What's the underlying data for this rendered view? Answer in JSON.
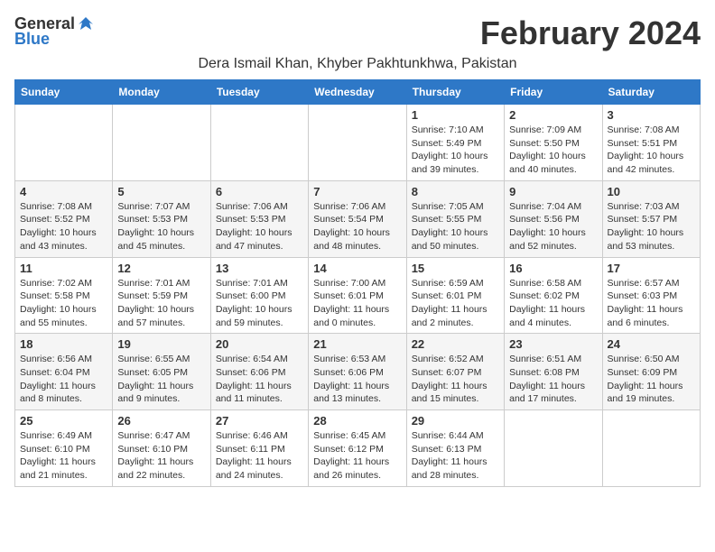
{
  "logo": {
    "general": "General",
    "blue": "Blue"
  },
  "title": "February 2024",
  "subtitle": "Dera Ismail Khan, Khyber Pakhtunkhwa, Pakistan",
  "headers": [
    "Sunday",
    "Monday",
    "Tuesday",
    "Wednesday",
    "Thursday",
    "Friday",
    "Saturday"
  ],
  "weeks": [
    [
      {
        "day": "",
        "sunrise": "",
        "sunset": "",
        "daylight": ""
      },
      {
        "day": "",
        "sunrise": "",
        "sunset": "",
        "daylight": ""
      },
      {
        "day": "",
        "sunrise": "",
        "sunset": "",
        "daylight": ""
      },
      {
        "day": "",
        "sunrise": "",
        "sunset": "",
        "daylight": ""
      },
      {
        "day": "1",
        "sunrise": "Sunrise: 7:10 AM",
        "sunset": "Sunset: 5:49 PM",
        "daylight": "Daylight: 10 hours and 39 minutes."
      },
      {
        "day": "2",
        "sunrise": "Sunrise: 7:09 AM",
        "sunset": "Sunset: 5:50 PM",
        "daylight": "Daylight: 10 hours and 40 minutes."
      },
      {
        "day": "3",
        "sunrise": "Sunrise: 7:08 AM",
        "sunset": "Sunset: 5:51 PM",
        "daylight": "Daylight: 10 hours and 42 minutes."
      }
    ],
    [
      {
        "day": "4",
        "sunrise": "Sunrise: 7:08 AM",
        "sunset": "Sunset: 5:52 PM",
        "daylight": "Daylight: 10 hours and 43 minutes."
      },
      {
        "day": "5",
        "sunrise": "Sunrise: 7:07 AM",
        "sunset": "Sunset: 5:53 PM",
        "daylight": "Daylight: 10 hours and 45 minutes."
      },
      {
        "day": "6",
        "sunrise": "Sunrise: 7:06 AM",
        "sunset": "Sunset: 5:53 PM",
        "daylight": "Daylight: 10 hours and 47 minutes."
      },
      {
        "day": "7",
        "sunrise": "Sunrise: 7:06 AM",
        "sunset": "Sunset: 5:54 PM",
        "daylight": "Daylight: 10 hours and 48 minutes."
      },
      {
        "day": "8",
        "sunrise": "Sunrise: 7:05 AM",
        "sunset": "Sunset: 5:55 PM",
        "daylight": "Daylight: 10 hours and 50 minutes."
      },
      {
        "day": "9",
        "sunrise": "Sunrise: 7:04 AM",
        "sunset": "Sunset: 5:56 PM",
        "daylight": "Daylight: 10 hours and 52 minutes."
      },
      {
        "day": "10",
        "sunrise": "Sunrise: 7:03 AM",
        "sunset": "Sunset: 5:57 PM",
        "daylight": "Daylight: 10 hours and 53 minutes."
      }
    ],
    [
      {
        "day": "11",
        "sunrise": "Sunrise: 7:02 AM",
        "sunset": "Sunset: 5:58 PM",
        "daylight": "Daylight: 10 hours and 55 minutes."
      },
      {
        "day": "12",
        "sunrise": "Sunrise: 7:01 AM",
        "sunset": "Sunset: 5:59 PM",
        "daylight": "Daylight: 10 hours and 57 minutes."
      },
      {
        "day": "13",
        "sunrise": "Sunrise: 7:01 AM",
        "sunset": "Sunset: 6:00 PM",
        "daylight": "Daylight: 10 hours and 59 minutes."
      },
      {
        "day": "14",
        "sunrise": "Sunrise: 7:00 AM",
        "sunset": "Sunset: 6:01 PM",
        "daylight": "Daylight: 11 hours and 0 minutes."
      },
      {
        "day": "15",
        "sunrise": "Sunrise: 6:59 AM",
        "sunset": "Sunset: 6:01 PM",
        "daylight": "Daylight: 11 hours and 2 minutes."
      },
      {
        "day": "16",
        "sunrise": "Sunrise: 6:58 AM",
        "sunset": "Sunset: 6:02 PM",
        "daylight": "Daylight: 11 hours and 4 minutes."
      },
      {
        "day": "17",
        "sunrise": "Sunrise: 6:57 AM",
        "sunset": "Sunset: 6:03 PM",
        "daylight": "Daylight: 11 hours and 6 minutes."
      }
    ],
    [
      {
        "day": "18",
        "sunrise": "Sunrise: 6:56 AM",
        "sunset": "Sunset: 6:04 PM",
        "daylight": "Daylight: 11 hours and 8 minutes."
      },
      {
        "day": "19",
        "sunrise": "Sunrise: 6:55 AM",
        "sunset": "Sunset: 6:05 PM",
        "daylight": "Daylight: 11 hours and 9 minutes."
      },
      {
        "day": "20",
        "sunrise": "Sunrise: 6:54 AM",
        "sunset": "Sunset: 6:06 PM",
        "daylight": "Daylight: 11 hours and 11 minutes."
      },
      {
        "day": "21",
        "sunrise": "Sunrise: 6:53 AM",
        "sunset": "Sunset: 6:06 PM",
        "daylight": "Daylight: 11 hours and 13 minutes."
      },
      {
        "day": "22",
        "sunrise": "Sunrise: 6:52 AM",
        "sunset": "Sunset: 6:07 PM",
        "daylight": "Daylight: 11 hours and 15 minutes."
      },
      {
        "day": "23",
        "sunrise": "Sunrise: 6:51 AM",
        "sunset": "Sunset: 6:08 PM",
        "daylight": "Daylight: 11 hours and 17 minutes."
      },
      {
        "day": "24",
        "sunrise": "Sunrise: 6:50 AM",
        "sunset": "Sunset: 6:09 PM",
        "daylight": "Daylight: 11 hours and 19 minutes."
      }
    ],
    [
      {
        "day": "25",
        "sunrise": "Sunrise: 6:49 AM",
        "sunset": "Sunset: 6:10 PM",
        "daylight": "Daylight: 11 hours and 21 minutes."
      },
      {
        "day": "26",
        "sunrise": "Sunrise: 6:47 AM",
        "sunset": "Sunset: 6:10 PM",
        "daylight": "Daylight: 11 hours and 22 minutes."
      },
      {
        "day": "27",
        "sunrise": "Sunrise: 6:46 AM",
        "sunset": "Sunset: 6:11 PM",
        "daylight": "Daylight: 11 hours and 24 minutes."
      },
      {
        "day": "28",
        "sunrise": "Sunrise: 6:45 AM",
        "sunset": "Sunset: 6:12 PM",
        "daylight": "Daylight: 11 hours and 26 minutes."
      },
      {
        "day": "29",
        "sunrise": "Sunrise: 6:44 AM",
        "sunset": "Sunset: 6:13 PM",
        "daylight": "Daylight: 11 hours and 28 minutes."
      },
      {
        "day": "",
        "sunrise": "",
        "sunset": "",
        "daylight": ""
      },
      {
        "day": "",
        "sunrise": "",
        "sunset": "",
        "daylight": ""
      }
    ]
  ]
}
